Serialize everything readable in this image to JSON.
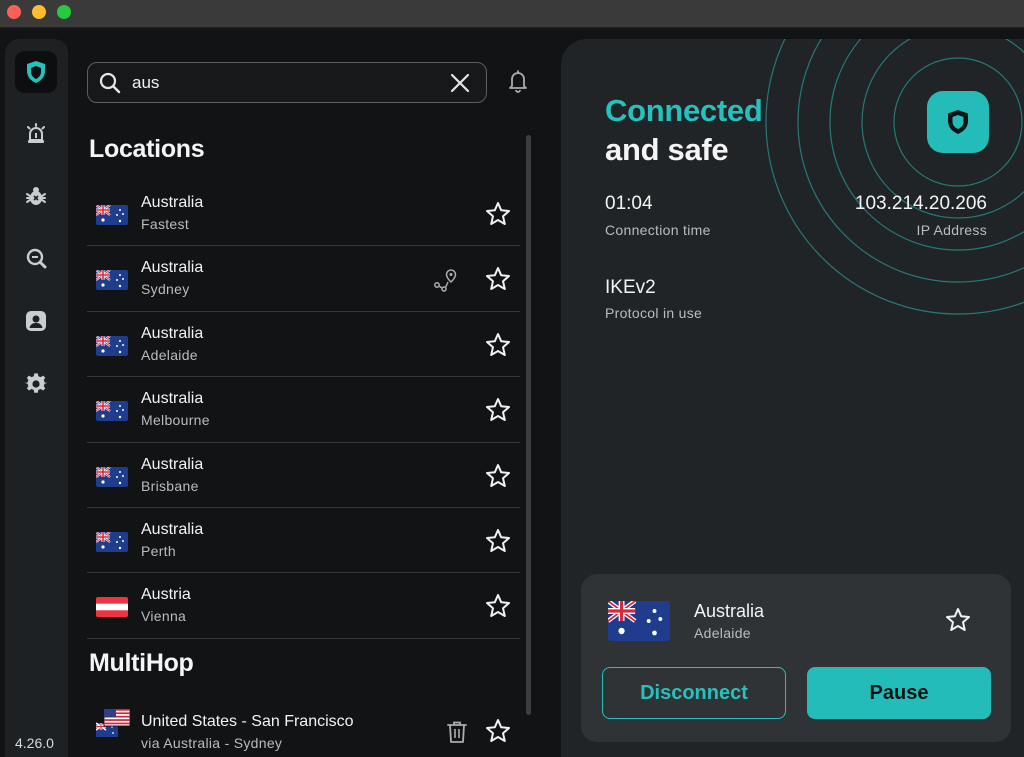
{
  "app": {
    "version": "4.26.0"
  },
  "search": {
    "value": "aus"
  },
  "sections": {
    "locations": "Locations",
    "multihop": "MultiHop"
  },
  "locations": [
    {
      "name": "Australia",
      "city": "Fastest",
      "flag": "au"
    },
    {
      "name": "Australia",
      "city": "Sydney",
      "flag": "au"
    },
    {
      "name": "Australia",
      "city": "Adelaide",
      "flag": "au"
    },
    {
      "name": "Australia",
      "city": "Melbourne",
      "flag": "au"
    },
    {
      "name": "Australia",
      "city": "Brisbane",
      "flag": "au"
    },
    {
      "name": "Australia",
      "city": "Perth",
      "flag": "au"
    },
    {
      "name": "Austria",
      "city": "Vienna",
      "flag": "at"
    }
  ],
  "multihop": {
    "name": "United States - San Francisco",
    "via": "via Australia - Sydney"
  },
  "status": {
    "headline_1": "Connected",
    "headline_2": "and safe",
    "connection_time_value": "01:04",
    "connection_time_label": "Connection time",
    "ip_value": "103.214.20.206",
    "ip_label": "IP Address",
    "protocol_value": "IKEv2",
    "protocol_label": "Protocol in use"
  },
  "current": {
    "name": "Australia",
    "city": "Adelaide",
    "disconnect_label": "Disconnect",
    "pause_label": "Pause"
  },
  "colors": {
    "accent": "#26c1bd",
    "background": "#111314",
    "card": "#2f3336"
  }
}
